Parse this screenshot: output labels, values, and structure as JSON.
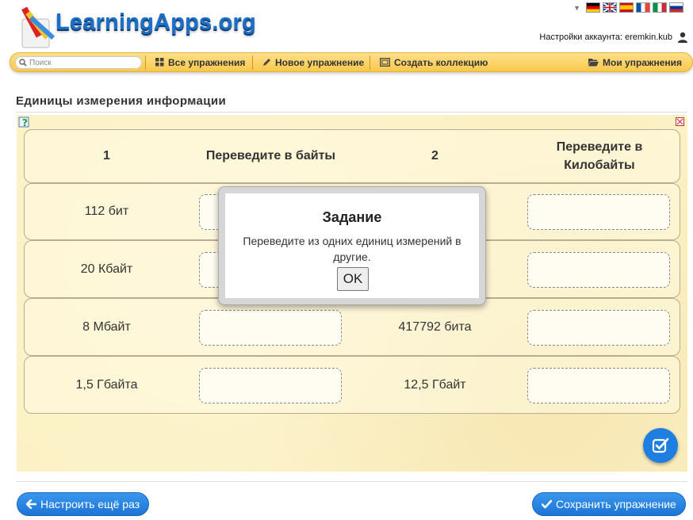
{
  "header": {
    "logo_text": "LearningApps.org",
    "account_label": "Настройки аккаунта: eremkin.kub",
    "languages": [
      "de",
      "en",
      "es",
      "fr",
      "it",
      "ru"
    ]
  },
  "nav": {
    "search_placeholder": "Поиск",
    "all_exercises": "Все упражнения",
    "new_exercise": "Новое упражнение",
    "create_collection": "Создать коллекцию",
    "my_exercises": "Мои упражнения"
  },
  "page": {
    "title": "Единицы измерения информации"
  },
  "table": {
    "headers": [
      "1",
      "Переведите в байты",
      "2",
      "Переведите в Килобайты"
    ],
    "rows": [
      {
        "left": "112 бит",
        "right": ""
      },
      {
        "left": "20 Кбайт",
        "right": ""
      },
      {
        "left": "8 Мбайт",
        "right": "417792 бита"
      },
      {
        "left": "1,5 Гбайта",
        "right": "12,5 Гбайт"
      }
    ]
  },
  "modal": {
    "title": "Задание",
    "text": "Переведите из одних единиц измерений в другие.",
    "ok": "OK"
  },
  "footer": {
    "back_label": "Настроить ещё раз",
    "save_label": "Сохранить упражнение"
  },
  "colors": {
    "accent_blue": "#1f7fe0",
    "nav_yellow": "#f9c94c",
    "app_background": "#fcf1c4"
  }
}
